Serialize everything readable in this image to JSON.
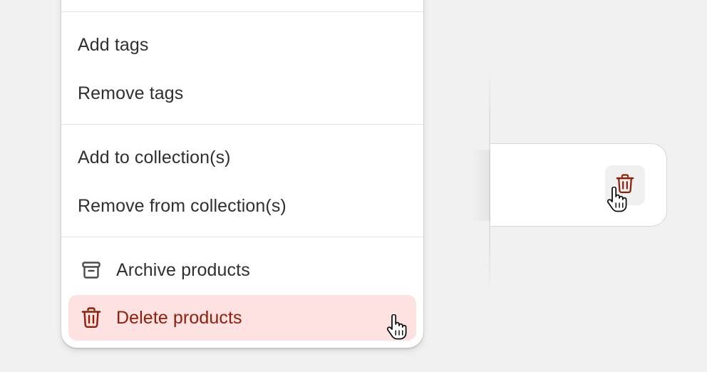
{
  "menu": {
    "items": [
      {
        "label": "Add tags"
      },
      {
        "label": "Remove tags"
      },
      {
        "label": "Add to collection(s)"
      },
      {
        "label": "Remove from collection(s)"
      },
      {
        "label": "Archive products",
        "icon": "archive-icon"
      },
      {
        "label": "Delete products",
        "icon": "trash-icon",
        "state": "hovered"
      }
    ]
  },
  "card": {
    "button_icon": "trash-icon",
    "button_state": "hovered"
  },
  "colors": {
    "danger_text": "#8e1f0b",
    "danger_bg": "#fee1e1",
    "text": "#303030",
    "divider": "#e3e3e3",
    "page_bg": "#f1f1f1"
  }
}
